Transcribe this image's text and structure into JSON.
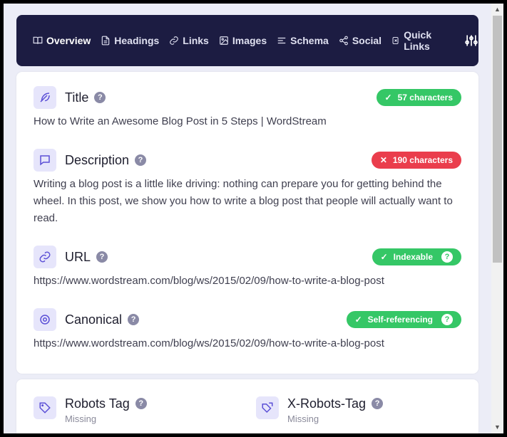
{
  "nav": {
    "items": [
      {
        "label": "Overview",
        "icon": "book-open-icon"
      },
      {
        "label": "Headings",
        "icon": "document-icon"
      },
      {
        "label": "Links",
        "icon": "link-icon"
      },
      {
        "label": "Images",
        "icon": "image-icon"
      },
      {
        "label": "Schema",
        "icon": "align-left-icon"
      },
      {
        "label": "Social",
        "icon": "share-icon"
      },
      {
        "label": "Quick Links",
        "icon": "quick-links-icon"
      }
    ],
    "active": "Overview"
  },
  "overview": {
    "title": {
      "label": "Title",
      "value": "How to Write an Awesome Blog Post in 5 Steps | WordStream",
      "badge": "57 characters",
      "badge_mark": "✓"
    },
    "description": {
      "label": "Description",
      "value": "Writing a blog post is a little like driving: nothing can prepare you for getting behind the wheel. In this post, we show you how to write a blog post that people will actually want to read.",
      "badge": "190 characters",
      "badge_mark": "✕"
    },
    "url": {
      "label": "URL",
      "value": "https://www.wordstream.com/blog/ws/2015/02/09/how-to-write-a-blog-post",
      "badge": "Indexable",
      "badge_mark": "✓"
    },
    "canonical": {
      "label": "Canonical",
      "value": "https://www.wordstream.com/blog/ws/2015/02/09/how-to-write-a-blog-post",
      "badge": "Self-referencing",
      "badge_mark": "✓"
    }
  },
  "robots": {
    "robots_tag": {
      "label": "Robots Tag",
      "value": "Missing"
    },
    "x_robots_tag": {
      "label": "X-Robots-Tag",
      "value": "Missing"
    }
  },
  "help_glyph": "?",
  "colors": {
    "nav_bg": "#1c1c42",
    "accent": "#5b4fd6",
    "ok": "#35c766",
    "error": "#ea3d4c"
  }
}
